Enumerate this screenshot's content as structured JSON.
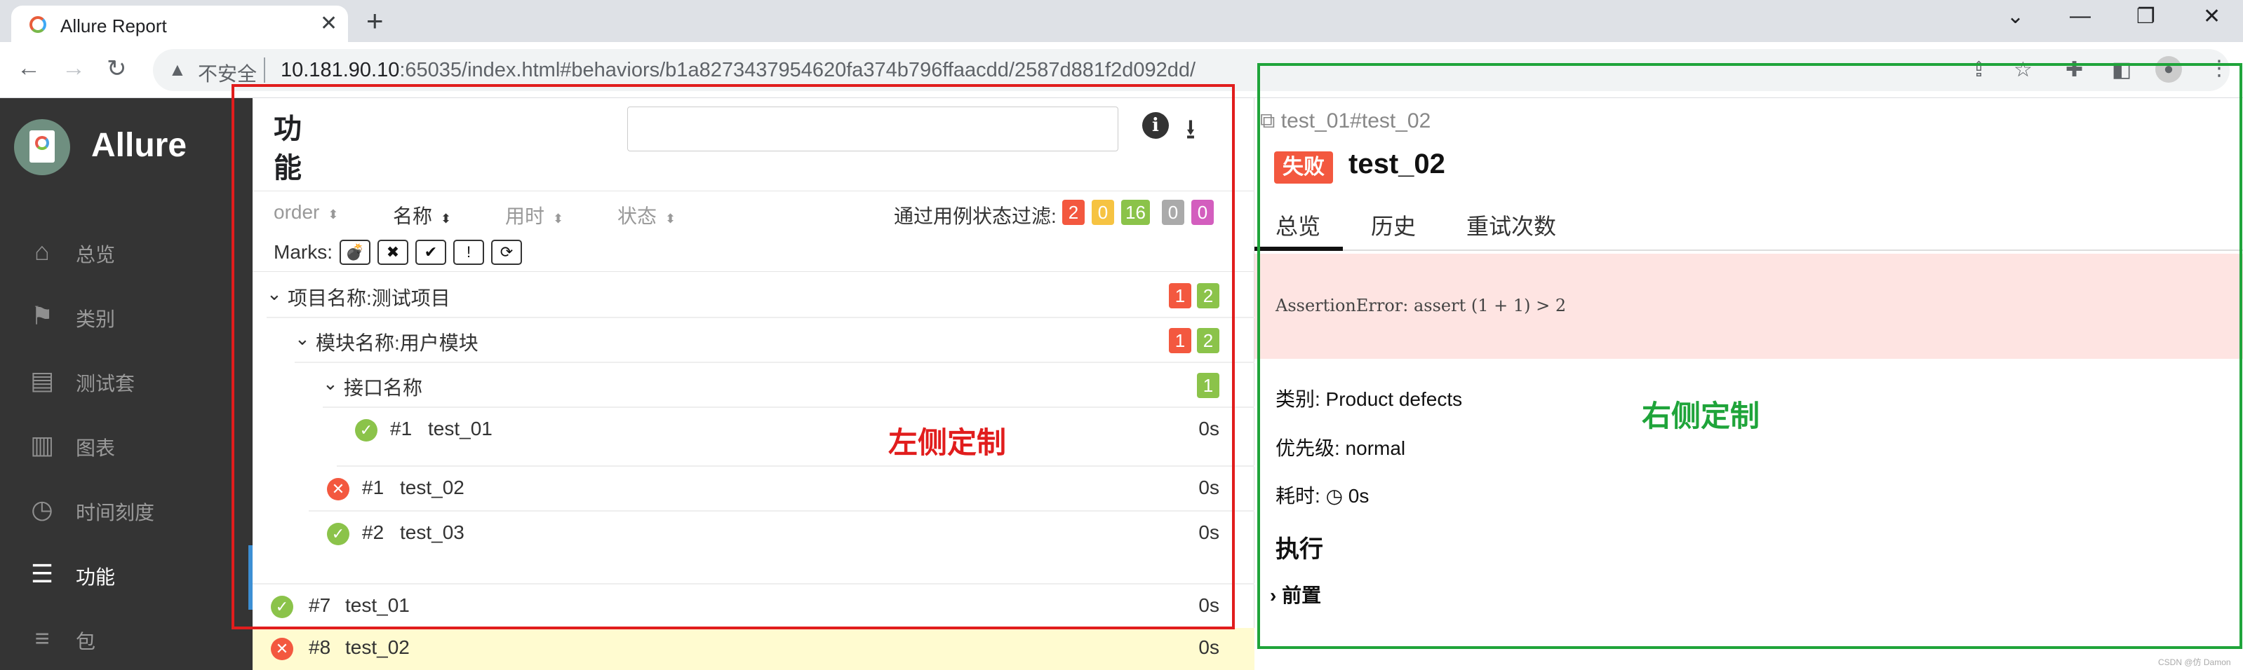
{
  "browser": {
    "tab_title": "Allure Report",
    "tab_close": "✕",
    "new_tab": "+",
    "win_min": "⌄",
    "win_minimize": "—",
    "win_restore": "❐",
    "win_close": "✕",
    "back": "←",
    "forward": "→",
    "reload": "↻",
    "security_label": "不安全",
    "url_host": "10.181.90.10",
    "url_rest": ":65035/index.html#behaviors/b1a8273437954620fa374b796ffaacdd/2587d881f2d092dd/",
    "icons": [
      "share-icon",
      "star-icon",
      "extensions-icon",
      "sidepanel-icon",
      "profile-icon",
      "menu-icon"
    ]
  },
  "sidebar": {
    "brand": "Allure",
    "items": [
      {
        "label": "总览",
        "icon": "home-icon"
      },
      {
        "label": "类别",
        "icon": "flag-icon"
      },
      {
        "label": "测试套",
        "icon": "briefcase-icon"
      },
      {
        "label": "图表",
        "icon": "bar-chart-icon"
      },
      {
        "label": "时间刻度",
        "icon": "clock-icon"
      },
      {
        "label": "功能",
        "icon": "list-icon"
      },
      {
        "label": "包",
        "icon": "align-left-icon"
      }
    ],
    "active_index": 5
  },
  "tree": {
    "title": "功能",
    "search_placeholder": "",
    "columns": [
      {
        "label": "order",
        "active": false
      },
      {
        "label": "名称",
        "active": true
      },
      {
        "label": "用时",
        "active": false
      },
      {
        "label": "状态",
        "active": false
      }
    ],
    "sort_arrow": "⬍",
    "filter_label": "通过用例状态过滤:",
    "filter_counts": {
      "failed": "2",
      "broken": "0",
      "passed": "16",
      "skipped": "0",
      "unknown": "0"
    },
    "marks_label": "Marks:",
    "marks": [
      "💣",
      "✖",
      "✔",
      "!",
      "⟳"
    ],
    "groups": [
      {
        "name": "项目名称:测试项目",
        "fail": "1",
        "pass": "2"
      },
      {
        "name": "模块名称:用户模块",
        "fail": "1",
        "pass": "2"
      },
      {
        "name": "接口名称",
        "pass": "1"
      }
    ],
    "tests": [
      {
        "num": "#1",
        "name": "test_01",
        "dur": "0s",
        "status": "passed"
      },
      {
        "num": "#1",
        "name": "test_02",
        "dur": "0s",
        "status": "failed"
      },
      {
        "num": "#2",
        "name": "test_03",
        "dur": "0s",
        "status": "passed"
      },
      {
        "num": "#7",
        "name": "test_01",
        "dur": "0s",
        "status": "passed"
      },
      {
        "num": "#8",
        "name": "test_02",
        "dur": "0s",
        "status": "failed"
      }
    ],
    "annotation": "左侧定制"
  },
  "detail": {
    "breadcrumb": "test_01#test_02",
    "status_badge": "失败",
    "title": "test_02",
    "tabs": [
      "总览",
      "历史",
      "重试次数"
    ],
    "error": "AssertionError: assert (1 + 1) > 2",
    "category": "类别: Product defects",
    "severity": "优先级: normal",
    "duration_label": "耗时:",
    "duration_value": "0s",
    "execution": "执行",
    "setup": "前置",
    "annotation": "右侧定制"
  },
  "watermark": "CSDN @仿 Damon",
  "colors": {
    "failed": "#f3583f",
    "passed": "#8bc34a",
    "broken": "#f6c342",
    "skipped": "#aaaaaa",
    "unknown": "#d35ebe",
    "annotation_left": "#e11d1d",
    "annotation_right": "#1fa43a"
  }
}
